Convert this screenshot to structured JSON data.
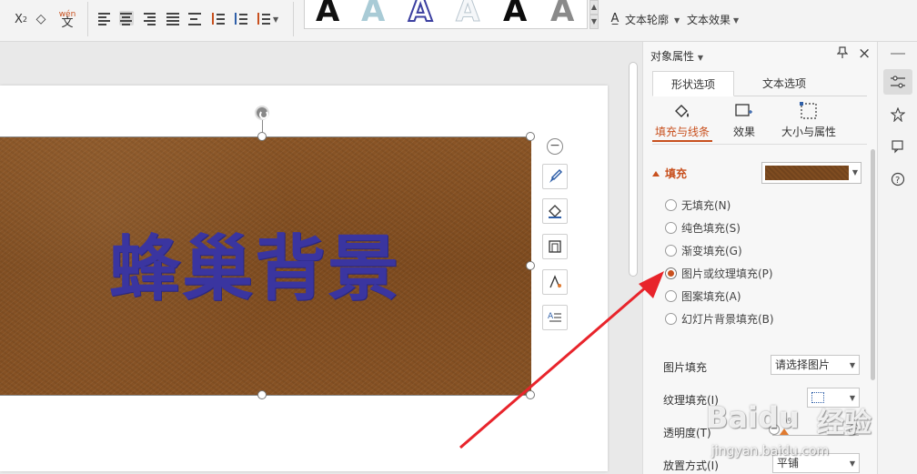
{
  "ribbon": {
    "pinyin_label": "wén",
    "align_buttons": [
      "align-left",
      "align-center",
      "align-right",
      "align-justify",
      "distributed",
      "line-spacing",
      "paragraph-spacing",
      "indent"
    ],
    "word_art_styles": [
      {
        "letter": "A",
        "color": "#111111",
        "style": "solid-black"
      },
      {
        "letter": "A",
        "color": "#a9cbd6",
        "style": "light-blue"
      },
      {
        "letter": "A",
        "color": "#3b3fa0",
        "style": "blue-outline"
      },
      {
        "letter": "A",
        "color": "#e9eef2",
        "style": "white-outline"
      },
      {
        "letter": "A",
        "color": "#0c0c0c",
        "style": "black"
      },
      {
        "letter": "A",
        "color": "#777777",
        "style": "gray-gradient"
      }
    ],
    "text_outline_label": "文本轮廓",
    "text_effect_label": "文本效果"
  },
  "slide": {
    "shape_text": "蜂巢背景",
    "shape_text_color": "#3a35a0",
    "shape_fill_color": "#7e4b1f"
  },
  "float_tools": [
    "minus-icon",
    "brush-icon",
    "fill-bucket-icon",
    "frame-icon",
    "text-fill-icon",
    "text-wrap-icon"
  ],
  "panel": {
    "title": "对象属性",
    "tabs": [
      "形状选项",
      "文本选项"
    ],
    "subtabs": [
      "填充与线条",
      "效果",
      "大小与属性"
    ],
    "fill_section_label": "填充",
    "fill_options": [
      {
        "label": "无填充(N)",
        "checked": false
      },
      {
        "label": "纯色填充(S)",
        "checked": false
      },
      {
        "label": "渐变填充(G)",
        "checked": false
      },
      {
        "label": "图片或纹理填充(P)",
        "checked": true
      },
      {
        "label": "图案填充(A)",
        "checked": false
      },
      {
        "label": "幻灯片背景填充(B)",
        "checked": false
      }
    ],
    "picture_fill_label": "图片填充",
    "picture_fill_value": "请选择图片",
    "texture_fill_label": "纹理填充(I)",
    "transparency_label": "透明度(T)",
    "transparency_value": "0%",
    "placement_label": "放置方式(I)",
    "placement_value": "平铺"
  },
  "sidebar_icons": [
    "properties-icon",
    "star-pin-icon",
    "comment-icon",
    "help-icon"
  ],
  "watermark": {
    "brand": "Baidu",
    "cn": "经验",
    "url": "jingyan.baidu.com"
  },
  "accent_color": "#c8501e"
}
